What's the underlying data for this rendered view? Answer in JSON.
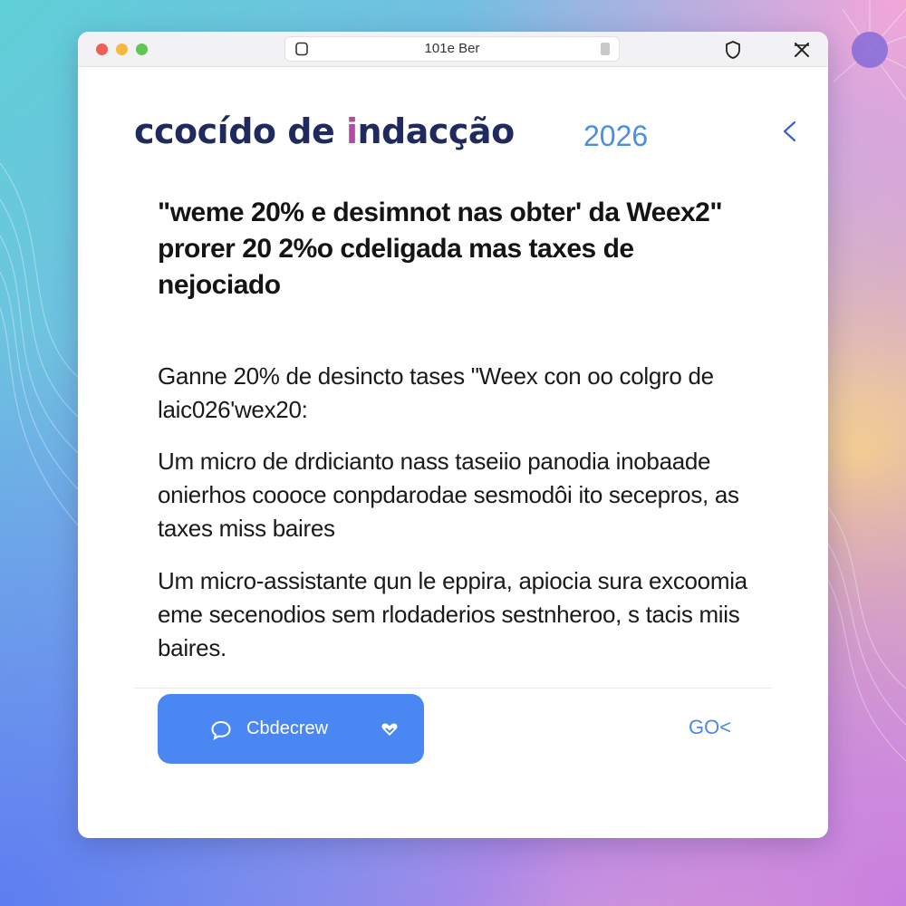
{
  "window": {
    "address_text": "101e Ber"
  },
  "header": {
    "title_part1": "ccocído de ",
    "title_accent": "i",
    "title_part2": "ndacção",
    "year": "2026"
  },
  "content": {
    "quote": "\"weme 20% e desimnot nas obter' da Weex2\" prorer 20 2%o cdeligada mas taxes de nejociado",
    "paragraphs": [
      "Ganne 20% de desincto tases \"Weex con oo colgro de laic026'wex20:",
      "Um micro de drdicianto nass taseiio panodia inobaade onierhos coooce conpdarodae sesmodôi ito secepros, as taxes miss baires",
      "Um micro-assistante qun le eppira, apiocia sura excoomia eme secenodios sem rlodaderios sestnheroo, s tacis miis baires."
    ]
  },
  "footer": {
    "button_label": "Cbdecrew",
    "link_text": "GO<"
  },
  "colors": {
    "accent_blue": "#4a87f2",
    "heading_navy": "#1f2a5e",
    "heading_accent": "#b54aa6",
    "year_blue": "#4c8ee0"
  },
  "icons": [
    "tab-icon",
    "shield-icon",
    "close-icon",
    "back-chevron-icon",
    "chat-icon",
    "heart-icon"
  ]
}
